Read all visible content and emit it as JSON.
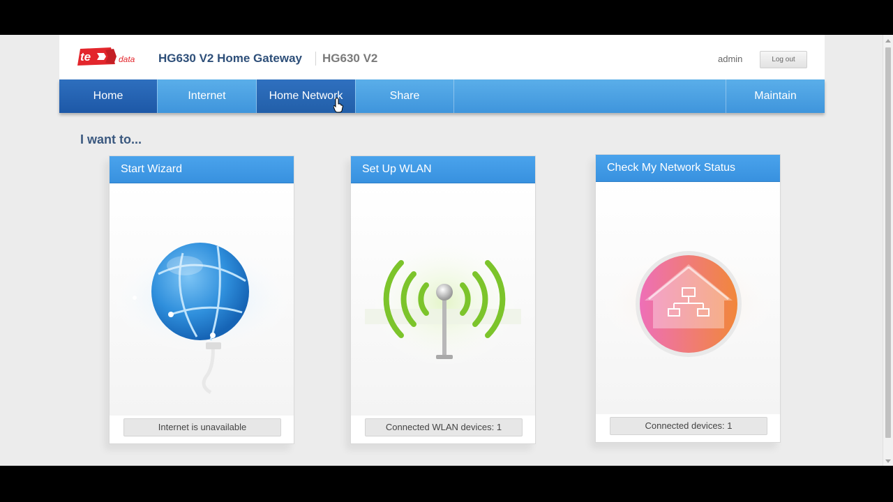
{
  "header": {
    "brand_name": "te data",
    "gateway_title": "HG630 V2 Home Gateway",
    "model": "HG630 V2",
    "user": "admin",
    "logout_label": "Log out"
  },
  "nav": {
    "items": [
      {
        "label": "Home",
        "active": true
      },
      {
        "label": "Internet"
      },
      {
        "label": "Home Network",
        "hovered": true
      },
      {
        "label": "Share"
      },
      {
        "label": "Maintain"
      }
    ]
  },
  "main": {
    "heading": "I want to...",
    "cards": [
      {
        "title": "Start Wizard",
        "icon": "globe-icon",
        "status": "Internet is unavailable"
      },
      {
        "title": "Set Up WLAN",
        "icon": "wifi-antenna-icon",
        "status": "Connected WLAN devices: 1"
      },
      {
        "title": "Check My Network Status",
        "icon": "home-network-icon",
        "status": "Connected devices: 1"
      }
    ]
  },
  "colors": {
    "brand_red": "#e3262c",
    "nav_blue": "#4a9fe6",
    "nav_active": "#2563ae",
    "title_blue": "#2e4f79"
  }
}
